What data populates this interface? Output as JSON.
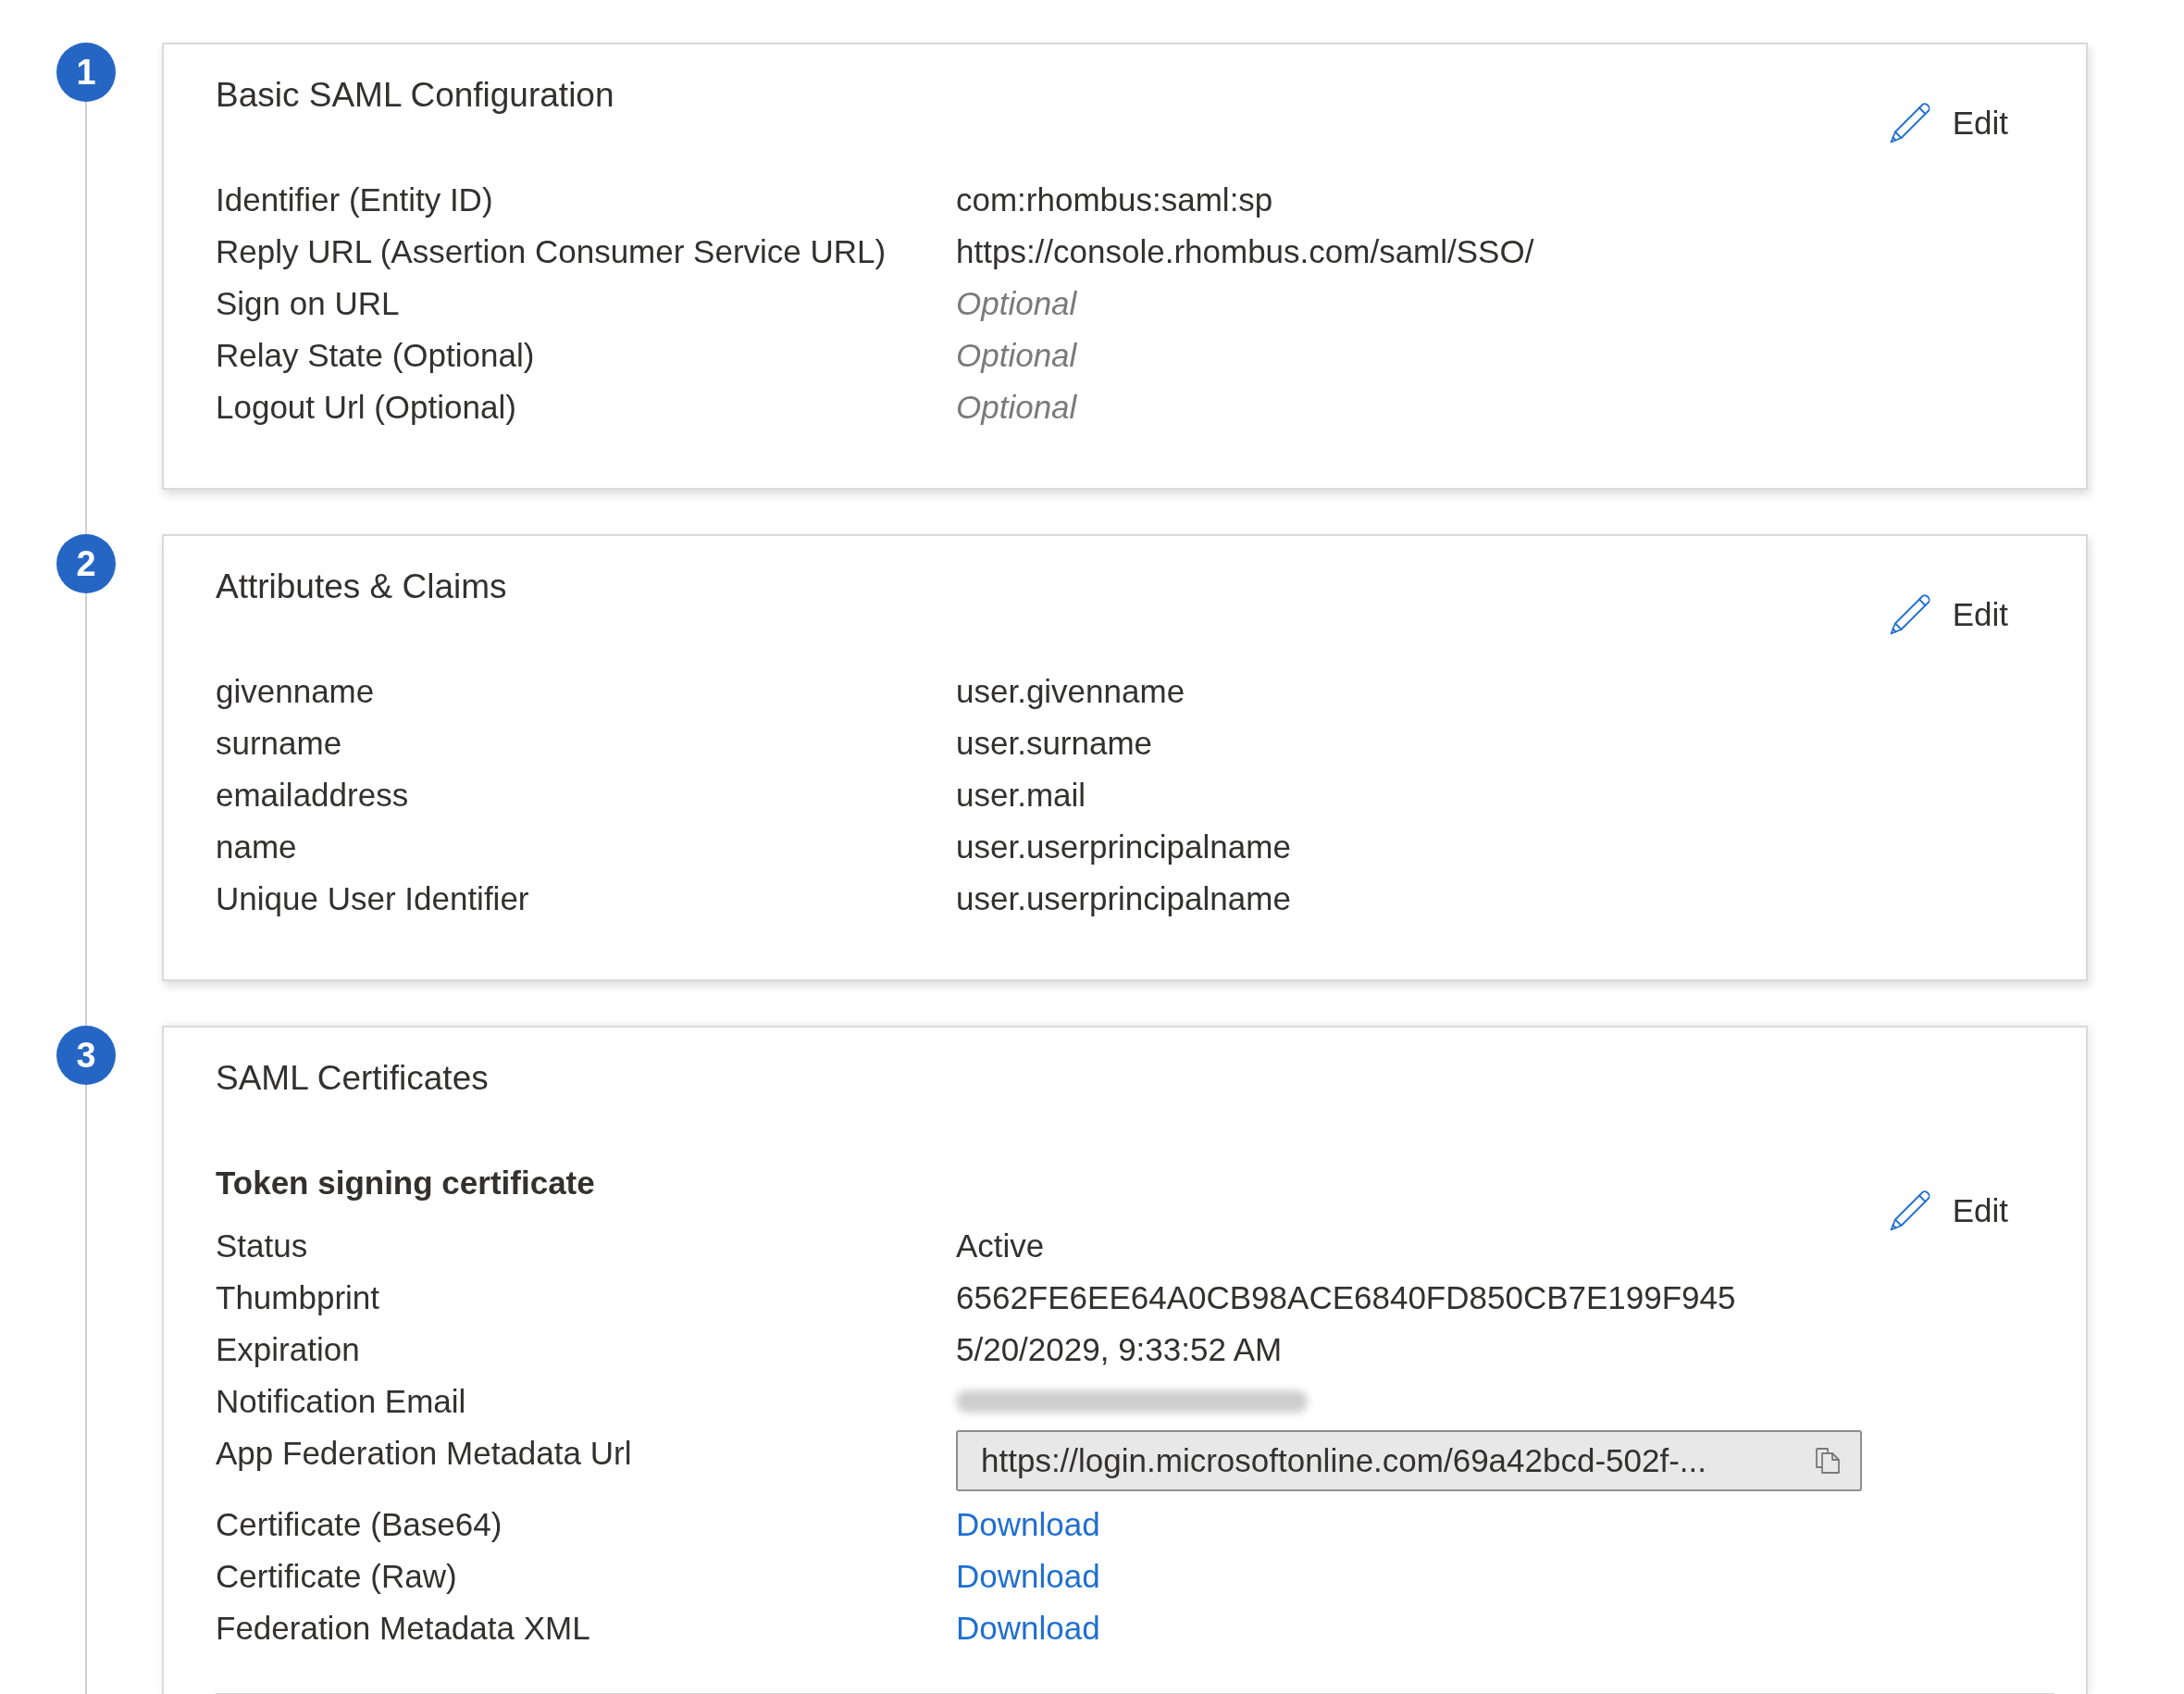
{
  "sections": [
    {
      "step": "1",
      "title": "Basic SAML Configuration",
      "edit_label": "Edit",
      "rows": [
        {
          "label": "Identifier (Entity ID)",
          "value": "com:rhombus:saml:sp",
          "kind": "text"
        },
        {
          "label": "Reply URL (Assertion Consumer Service URL)",
          "value": "https://console.rhombus.com/saml/SSO/",
          "kind": "text"
        },
        {
          "label": "Sign on URL",
          "value": "Optional",
          "kind": "hint"
        },
        {
          "label": "Relay State (Optional)",
          "value": "Optional",
          "kind": "hint"
        },
        {
          "label": "Logout Url (Optional)",
          "value": "Optional",
          "kind": "hint"
        }
      ]
    },
    {
      "step": "2",
      "title": "Attributes & Claims",
      "edit_label": "Edit",
      "rows": [
        {
          "label": "givenname",
          "value": "user.givenname",
          "kind": "text"
        },
        {
          "label": "surname",
          "value": "user.surname",
          "kind": "text"
        },
        {
          "label": "emailaddress",
          "value": "user.mail",
          "kind": "text"
        },
        {
          "label": "name",
          "value": "user.userprincipalname",
          "kind": "text"
        },
        {
          "label": "Unique User Identifier",
          "value": "user.userprincipalname",
          "kind": "text"
        }
      ]
    },
    {
      "step": "3",
      "title": "SAML Certificates",
      "subtitle": "Token signing certificate",
      "edit_label": "Edit",
      "rows": [
        {
          "label": "Status",
          "value": "Active",
          "kind": "text"
        },
        {
          "label": "Thumbprint",
          "value": "6562FE6EE64A0CB98ACE6840FD850CB7E199F945",
          "kind": "text"
        },
        {
          "label": "Expiration",
          "value": "5/20/2029, 9:33:52 AM",
          "kind": "text"
        },
        {
          "label": "Notification Email",
          "kind": "redacted"
        },
        {
          "label": "App Federation Metadata Url",
          "value": "https://login.microsoftonline.com/69a42bcd-502f-...",
          "kind": "field"
        },
        {
          "label": "Certificate (Base64)",
          "value": "Download",
          "kind": "link"
        },
        {
          "label": "Certificate (Raw)",
          "value": "Download",
          "kind": "link"
        },
        {
          "label": "Federation Metadata XML",
          "value": "Download",
          "kind": "link"
        }
      ]
    }
  ]
}
